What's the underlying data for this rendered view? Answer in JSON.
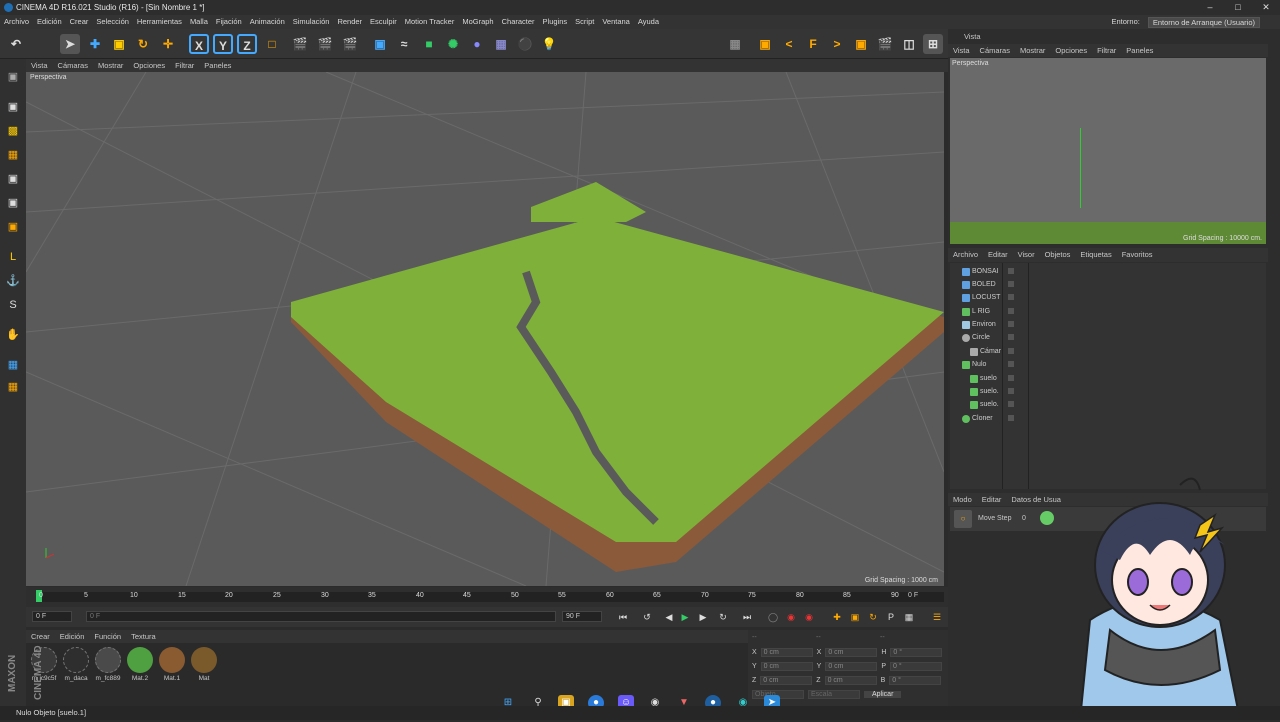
{
  "window": {
    "title": "CINEMA 4D R16.021 Studio (R16) - [Sin Nombre 1 *]"
  },
  "menu": [
    "Archivo",
    "Edición",
    "Crear",
    "Selección",
    "Herramientas",
    "Malla",
    "Fijación",
    "Animación",
    "Simulación",
    "Render",
    "Esculpir",
    "Motion Tracker",
    "MoGraph",
    "Character",
    "Plugins",
    "Script",
    "Ventana",
    "Ayuda"
  ],
  "entorno": {
    "label": "Entorno:",
    "value": "Entorno de Arranque (Usuario)"
  },
  "viewport": {
    "menu": [
      "Vista",
      "Cámaras",
      "Mostrar",
      "Opciones",
      "Filtrar",
      "Paneles"
    ],
    "label": "Perspectiva",
    "grid_spacing": "Grid Spacing : 1000 cm",
    "colors": {
      "bg": "#5a5a5a",
      "grass": "#7fb13a",
      "dirt": "#8a5a3a"
    }
  },
  "timeline": {
    "ticks": [
      "0",
      "5",
      "10",
      "15",
      "20",
      "25",
      "30",
      "35",
      "40",
      "45",
      "50",
      "55",
      "60",
      "65",
      "70",
      "75",
      "80",
      "85",
      "90"
    ],
    "current_frame": "0 F",
    "start": "0 F",
    "start2": "0 F",
    "end": "90 F",
    "end2": "90 F"
  },
  "materials": {
    "menu": [
      "Crear",
      "Edición",
      "Función",
      "Textura"
    ],
    "items": [
      {
        "name": "m_c9c5f",
        "color": "#3a3a3a"
      },
      {
        "name": "m_daca",
        "color": "#2e2e2e"
      },
      {
        "name": "m_fc889",
        "color": "#4a4a4a"
      },
      {
        "name": "Mat.2",
        "color": "#4fa040"
      },
      {
        "name": "Mat.1",
        "color": "#8a5a30"
      },
      {
        "name": "Mat",
        "color": "#7a5a2a"
      }
    ]
  },
  "coords": {
    "headers": [
      "--",
      "--",
      "--"
    ],
    "rows": [
      {
        "a": "X",
        "av": "0 cm",
        "b": "X",
        "bv": "0 cm",
        "c": "H",
        "cv": "0 °"
      },
      {
        "a": "Y",
        "av": "0 cm",
        "b": "Y",
        "bv": "0 cm",
        "c": "P",
        "cv": "0 °"
      },
      {
        "a": "Z",
        "av": "0 cm",
        "b": "Z",
        "bv": "0 cm",
        "c": "B",
        "cv": "0 °"
      }
    ],
    "mode": "Objeto",
    "scale": "Escala",
    "apply": "Aplicar"
  },
  "status": "Nulo Objeto [suelo.1]",
  "maxon_logo": "MAXON CINEMA 4D",
  "vista": {
    "title": "Vista",
    "menu": [
      "Vista",
      "Cámaras",
      "Mostrar",
      "Opciones",
      "Filtrar",
      "Paneles"
    ],
    "label": "Perspectiva",
    "grid_spacing": "Grid Spacing : 10000 cm."
  },
  "objects": {
    "menu": [
      "Archivo",
      "Editar",
      "Visor",
      "Objetos",
      "Etiquetas",
      "Favoritos"
    ],
    "items": [
      {
        "name": "BONSAI",
        "color": "#5fa0e0"
      },
      {
        "name": "BOLED",
        "color": "#5fa0e0"
      },
      {
        "name": "LOCUST",
        "color": "#5fa0e0"
      },
      {
        "name": "L RIG",
        "color": "#60c060"
      },
      {
        "name": "Environ",
        "color": "#a0c8e0"
      },
      {
        "name": "Circle",
        "color": "#aaaaaa"
      },
      {
        "name": "Cámar",
        "color": "#aaaaaa"
      },
      {
        "name": "Nulo",
        "color": "#60c060"
      },
      {
        "name": "suelo",
        "color": "#60c060"
      },
      {
        "name": "suelo.",
        "color": "#60c060"
      },
      {
        "name": "suelo.",
        "color": "#60c060"
      },
      {
        "name": "Cloner",
        "color": "#60c060"
      }
    ]
  },
  "attributes": {
    "menu": [
      "Modo",
      "Editar",
      "Datos de Usua"
    ],
    "tool": "Move Step",
    "value": "0"
  }
}
